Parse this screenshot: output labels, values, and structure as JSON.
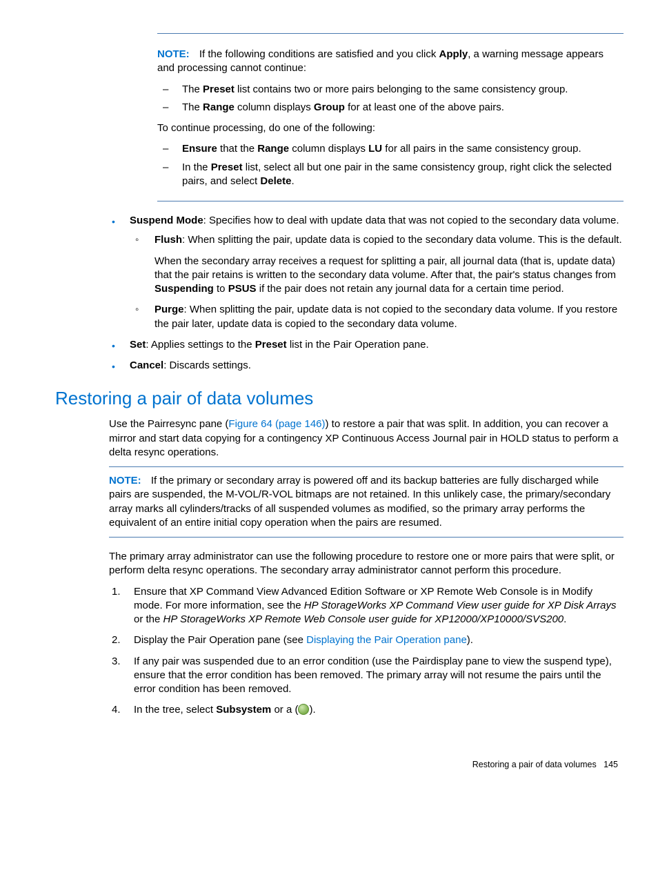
{
  "note1": {
    "label": "NOTE:",
    "intro_a": "If the following conditions are satisfied and you click ",
    "intro_bold": "Apply",
    "intro_b": ", a warning message appears and processing cannot continue:",
    "c1_a": "The ",
    "c1_b": "Preset",
    "c1_c": " list contains two or more pairs belonging to the same consistency group.",
    "c2_a": "The ",
    "c2_b": "Range",
    "c2_c": " column displays ",
    "c2_d": "Group",
    "c2_e": " for at least one of the above pairs.",
    "continue": "To continue processing, do one of the following:",
    "r1_a": "Ensure",
    "r1_b": " that the ",
    "r1_c": "Range",
    "r1_d": " column displays ",
    "r1_e": "LU",
    "r1_f": " for all pairs in the same consistency group.",
    "r2_a": "In the ",
    "r2_b": "Preset",
    "r2_c": " list, select all but one pair in the same consistency group, right click the selected pairs, and select ",
    "r2_d": "Delete",
    "r2_e": "."
  },
  "bl": {
    "suspend_a": "Suspend Mode",
    "suspend_b": ": Specifies how to deal with update data that was not copied to the secondary data volume.",
    "flush_a": "Flush",
    "flush_b": ": When splitting the pair, update data is copied to the secondary data volume. This is the default.",
    "flush_p_a": "When the secondary array receives a request for splitting a pair, all journal data (that is, update data) that the pair retains is written to the secondary data volume. After that, the pair's status changes from ",
    "flush_p_b": "Suspending",
    "flush_p_c": " to ",
    "flush_p_d": "PSUS",
    "flush_p_e": " if the pair does not retain any journal data for a certain time period.",
    "purge_a": "Purge",
    "purge_b": ": When splitting the pair, update data is not copied to the secondary data volume. If you restore the pair later, update data is copied to the secondary data volume.",
    "set_a": "Set",
    "set_b": ": Applies settings to the ",
    "set_c": "Preset",
    "set_d": " list in the Pair Operation pane.",
    "cancel_a": "Cancel",
    "cancel_b": ": Discards settings."
  },
  "sec": {
    "title": "Restoring a pair of data volumes",
    "p1_a": "Use the Pairresync pane (",
    "p1_link": "Figure 64 (page 146)",
    "p1_b": ") to restore a pair that was split. In addition, you can recover a mirror and start data copying for a contingency XP Continuous Access Journal pair in HOLD status to perform a delta resync operations."
  },
  "note2": {
    "label": "NOTE:",
    "body": "If the primary or secondary array is powered off and its backup batteries are fully discharged while pairs are suspended, the M-VOL/R-VOL bitmaps are not retained. In this unlikely case, the primary/secondary array marks all cylinders/tracks of all suspended volumes as modified, so the primary array performs the equivalent of an entire initial copy operation when the pairs are resumed."
  },
  "p2": "The primary array administrator can use the following procedure to restore one or more pairs that were split, or perform delta resync operations. The secondary array administrator cannot perform this procedure.",
  "ol": {
    "s1_a": "Ensure that XP Command View Advanced Edition Software or XP Remote Web Console is in Modify mode. For more information, see the ",
    "s1_b": "HP StorageWorks XP Command View user guide for XP Disk Arrays",
    "s1_c": " or the ",
    "s1_d": "HP StorageWorks XP Remote Web Console user guide for XP12000/XP10000/SVS200",
    "s1_e": ".",
    "s2_a": "Display the Pair Operation pane (see ",
    "s2_link": "Displaying the Pair Operation pane",
    "s2_b": ").",
    "s3": "If any pair was suspended due to an error condition (use the Pairdisplay pane to view the suspend type), ensure that the error condition has been removed. The primary array will not resume the pairs until the error condition has been removed.",
    "s4_a": "In the tree, select ",
    "s4_b": "Subsystem",
    "s4_c": " or a (",
    "s4_d": ")."
  },
  "footer": {
    "text": "Restoring a pair of data volumes",
    "page": "145"
  }
}
